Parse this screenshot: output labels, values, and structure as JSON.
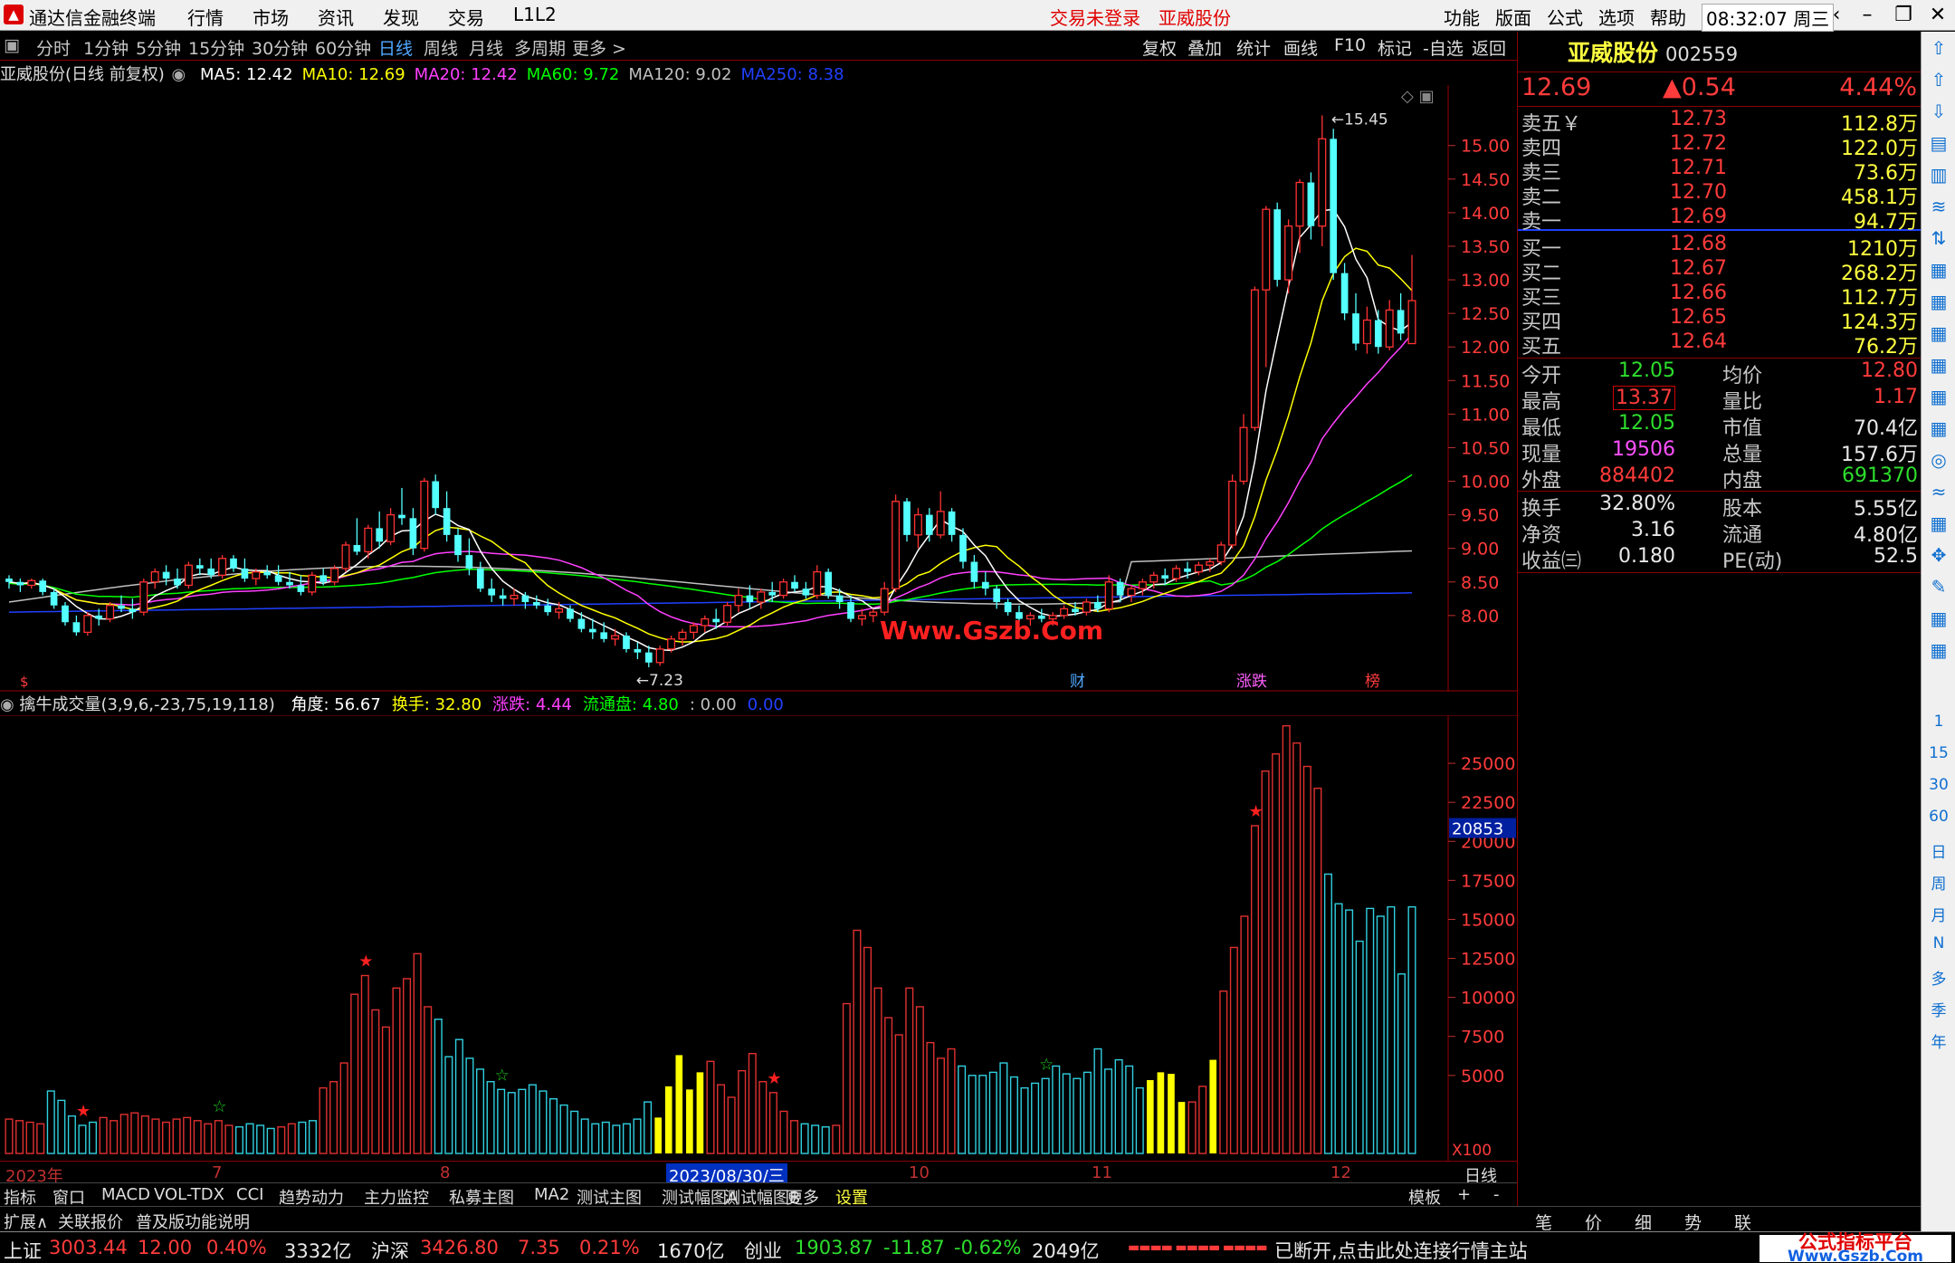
{
  "menubar": {
    "app_title": "通达信金融终端",
    "items": [
      "行情",
      "市场",
      "资讯",
      "发现",
      "交易",
      "L1L2"
    ],
    "trade_status": "交易未登录",
    "stock_name": "亚威股份",
    "right_items": [
      "功能",
      "版面",
      "公式",
      "选项",
      "帮助"
    ],
    "time": "08:32:07",
    "weekday": "周三"
  },
  "periods": {
    "items": [
      "分时",
      "1分钟",
      "5分钟",
      "15分钟",
      "30分钟",
      "60分钟",
      "日线",
      "周线",
      "月线",
      "多周期",
      "更多 >"
    ],
    "selected": "日线",
    "tools": [
      "复权",
      "叠加",
      "统计",
      "画线",
      "F10",
      "标记",
      "-自选",
      "返回"
    ]
  },
  "ma_legend": {
    "title": "亚威股份(日线 前复权)",
    "items": [
      {
        "label": "MA5: 12.42",
        "color": "#ffffff"
      },
      {
        "label": "MA10: 12.69",
        "color": "#ffff00"
      },
      {
        "label": "MA20: 12.42",
        "color": "#ff40ff"
      },
      {
        "label": "MA60: 9.72",
        "color": "#00ff00"
      },
      {
        "label": "MA120: 9.02",
        "color": "#c0c0c0"
      },
      {
        "label": "MA250: 8.38",
        "color": "#2040ff"
      }
    ]
  },
  "chart_data": [
    {
      "type": "candlestick",
      "title": "亚威股份(日线 前复权)",
      "y_ticks": [
        8.0,
        8.5,
        9.0,
        9.5,
        10.0,
        10.5,
        11.0,
        11.5,
        12.0,
        12.5,
        13.0,
        13.5,
        14.0,
        14.5,
        15.0
      ],
      "ylim": [
        7.0,
        15.9
      ],
      "high_label": "15.45",
      "low_label": "7.23",
      "time_ticks": [
        "2023年",
        "7",
        "8",
        "2023/08/30/三",
        "10",
        "11",
        "12"
      ],
      "period_label": "日线",
      "markers": [
        "财",
        "涨跌",
        "榜"
      ],
      "ohlc": [
        [
          8.55,
          8.6,
          8.4,
          8.5
        ],
        [
          8.5,
          8.55,
          8.35,
          8.45
        ],
        [
          8.45,
          8.55,
          8.4,
          8.52
        ],
        [
          8.52,
          8.55,
          8.3,
          8.35
        ],
        [
          8.35,
          8.4,
          8.1,
          8.15
        ],
        [
          8.15,
          8.2,
          7.85,
          7.9
        ],
        [
          7.9,
          8.0,
          7.7,
          7.75
        ],
        [
          7.75,
          8.05,
          7.7,
          8.0
        ],
        [
          8.0,
          8.1,
          7.85,
          7.95
        ],
        [
          7.95,
          8.2,
          7.9,
          8.15
        ],
        [
          8.15,
          8.3,
          8.05,
          8.1
        ],
        [
          8.1,
          8.25,
          7.95,
          8.05
        ],
        [
          8.05,
          8.55,
          8.0,
          8.5
        ],
        [
          8.5,
          8.7,
          8.4,
          8.65
        ],
        [
          8.65,
          8.75,
          8.45,
          8.55
        ],
        [
          8.55,
          8.7,
          8.4,
          8.45
        ],
        [
          8.45,
          8.8,
          8.4,
          8.75
        ],
        [
          8.75,
          8.85,
          8.6,
          8.7
        ],
        [
          8.7,
          8.85,
          8.55,
          8.6
        ],
        [
          8.6,
          8.9,
          8.55,
          8.85
        ],
        [
          8.85,
          8.9,
          8.65,
          8.7
        ],
        [
          8.7,
          8.85,
          8.5,
          8.55
        ],
        [
          8.55,
          8.7,
          8.45,
          8.65
        ],
        [
          8.65,
          8.75,
          8.55,
          8.6
        ],
        [
          8.6,
          8.75,
          8.45,
          8.5
        ],
        [
          8.5,
          8.65,
          8.4,
          8.45
        ],
        [
          8.45,
          8.6,
          8.3,
          8.35
        ],
        [
          8.35,
          8.65,
          8.3,
          8.6
        ],
        [
          8.6,
          8.7,
          8.45,
          8.5
        ],
        [
          8.5,
          8.75,
          8.45,
          8.7
        ],
        [
          8.7,
          9.1,
          8.65,
          9.05
        ],
        [
          9.05,
          9.45,
          8.9,
          8.95
        ],
        [
          8.95,
          9.35,
          8.85,
          9.3
        ],
        [
          9.3,
          9.55,
          9.0,
          9.1
        ],
        [
          9.1,
          9.6,
          9.05,
          9.5
        ],
        [
          9.5,
          9.9,
          9.35,
          9.45
        ],
        [
          9.45,
          9.6,
          8.9,
          9.0
        ],
        [
          9.0,
          10.05,
          8.95,
          10.0
        ],
        [
          10.0,
          10.1,
          9.5,
          9.6
        ],
        [
          9.6,
          9.85,
          9.1,
          9.2
        ],
        [
          9.2,
          9.3,
          8.8,
          8.9
        ],
        [
          8.9,
          9.15,
          8.6,
          8.7
        ],
        [
          8.7,
          8.8,
          8.35,
          8.4
        ],
        [
          8.4,
          8.55,
          8.2,
          8.3
        ],
        [
          8.3,
          8.4,
          8.15,
          8.25
        ],
        [
          8.25,
          8.4,
          8.15,
          8.3
        ],
        [
          8.3,
          8.35,
          8.1,
          8.2
        ],
        [
          8.2,
          8.3,
          8.1,
          8.15
        ],
        [
          8.15,
          8.25,
          8.0,
          8.05
        ],
        [
          8.05,
          8.2,
          7.95,
          8.1
        ],
        [
          8.1,
          8.15,
          7.9,
          7.95
        ],
        [
          7.95,
          8.05,
          7.75,
          7.8
        ],
        [
          7.8,
          7.95,
          7.65,
          7.75
        ],
        [
          7.75,
          7.9,
          7.6,
          7.65
        ],
        [
          7.65,
          7.8,
          7.55,
          7.7
        ],
        [
          7.7,
          7.75,
          7.45,
          7.5
        ],
        [
          7.5,
          7.6,
          7.35,
          7.45
        ],
        [
          7.45,
          7.55,
          7.23,
          7.3
        ],
        [
          7.3,
          7.55,
          7.25,
          7.5
        ],
        [
          7.5,
          7.7,
          7.45,
          7.65
        ],
        [
          7.65,
          7.8,
          7.55,
          7.75
        ],
        [
          7.75,
          7.9,
          7.65,
          7.85
        ],
        [
          7.85,
          8.0,
          7.75,
          7.95
        ],
        [
          7.95,
          8.1,
          7.8,
          7.9
        ],
        [
          7.9,
          8.2,
          7.85,
          8.15
        ],
        [
          8.15,
          8.4,
          8.05,
          8.3
        ],
        [
          8.3,
          8.45,
          8.1,
          8.2
        ],
        [
          8.2,
          8.4,
          8.1,
          8.35
        ],
        [
          8.35,
          8.5,
          8.2,
          8.3
        ],
        [
          8.3,
          8.55,
          8.25,
          8.5
        ],
        [
          8.5,
          8.6,
          8.35,
          8.4
        ],
        [
          8.4,
          8.5,
          8.25,
          8.3
        ],
        [
          8.3,
          8.75,
          8.25,
          8.65
        ],
        [
          8.65,
          8.7,
          8.25,
          8.3
        ],
        [
          8.3,
          8.4,
          8.1,
          8.2
        ],
        [
          8.2,
          8.3,
          7.9,
          7.95
        ],
        [
          7.95,
          8.1,
          7.85,
          8.0
        ],
        [
          8.0,
          8.1,
          7.9,
          8.05
        ],
        [
          8.05,
          8.5,
          8.0,
          8.4
        ],
        [
          8.4,
          9.8,
          8.35,
          9.7
        ],
        [
          9.7,
          9.75,
          9.1,
          9.2
        ],
        [
          9.2,
          9.6,
          9.0,
          9.5
        ],
        [
          9.5,
          9.6,
          9.1,
          9.2
        ],
        [
          9.2,
          9.85,
          9.15,
          9.55
        ],
        [
          9.55,
          9.6,
          9.1,
          9.2
        ],
        [
          9.2,
          9.3,
          8.7,
          8.8
        ],
        [
          8.8,
          8.9,
          8.4,
          8.5
        ],
        [
          8.5,
          8.65,
          8.3,
          8.4
        ],
        [
          8.4,
          8.45,
          8.1,
          8.2
        ],
        [
          8.2,
          8.25,
          8.0,
          8.05
        ],
        [
          8.05,
          8.15,
          7.9,
          7.95
        ],
        [
          7.95,
          8.05,
          7.85,
          8.0
        ],
        [
          8.0,
          8.1,
          7.9,
          7.95
        ],
        [
          7.95,
          8.05,
          7.85,
          8.0
        ],
        [
          8.0,
          8.15,
          7.95,
          8.1
        ],
        [
          8.1,
          8.2,
          8.0,
          8.05
        ],
        [
          8.05,
          8.25,
          8.0,
          8.2
        ],
        [
          8.2,
          8.3,
          8.05,
          8.1
        ],
        [
          8.1,
          8.6,
          8.05,
          8.5
        ],
        [
          8.5,
          8.55,
          8.2,
          8.3
        ],
        [
          8.3,
          8.45,
          8.2,
          8.4
        ],
        [
          8.4,
          8.55,
          8.3,
          8.5
        ],
        [
          8.5,
          8.65,
          8.4,
          8.6
        ],
        [
          8.6,
          8.7,
          8.45,
          8.55
        ],
        [
          8.55,
          8.75,
          8.5,
          8.7
        ],
        [
          8.7,
          8.8,
          8.55,
          8.65
        ],
        [
          8.65,
          8.8,
          8.6,
          8.75
        ],
        [
          8.75,
          8.85,
          8.65,
          8.8
        ],
        [
          8.8,
          9.1,
          8.75,
          9.05
        ],
        [
          9.05,
          10.1,
          9.0,
          10.0
        ],
        [
          10.0,
          11.0,
          9.95,
          10.8
        ],
        [
          10.8,
          12.9,
          10.75,
          12.85
        ],
        [
          12.85,
          14.1,
          11.7,
          14.05
        ],
        [
          14.05,
          14.15,
          12.9,
          13.0
        ],
        [
          13.0,
          13.9,
          12.8,
          13.8
        ],
        [
          13.8,
          14.5,
          13.4,
          14.45
        ],
        [
          14.45,
          14.6,
          13.6,
          13.8
        ],
        [
          13.8,
          15.45,
          13.5,
          15.1
        ],
        [
          15.1,
          15.25,
          13.0,
          13.1
        ],
        [
          13.1,
          13.25,
          12.4,
          12.5
        ],
        [
          12.5,
          12.8,
          11.95,
          12.05
        ],
        [
          12.05,
          12.6,
          11.9,
          12.4
        ],
        [
          12.4,
          12.55,
          11.9,
          12.0
        ],
        [
          12.0,
          12.7,
          11.95,
          12.55
        ],
        [
          12.55,
          12.8,
          12.1,
          12.2
        ],
        [
          12.05,
          13.37,
          12.05,
          12.69
        ]
      ]
    },
    {
      "type": "bar",
      "title": "擒牛成交量(3,9,6,-23,75,19,118)",
      "y_ticks": [
        5000,
        7500,
        10000,
        12500,
        15000,
        17500,
        20000,
        22500,
        25000
      ],
      "ylim": [
        0,
        27500
      ],
      "unit": "X100",
      "current_label": "20853",
      "values": [
        2200,
        2100,
        2000,
        1900,
        4000,
        3400,
        2400,
        1800,
        2000,
        2300,
        2100,
        2500,
        2600,
        2400,
        2200,
        2000,
        2200,
        2300,
        2100,
        1900,
        2100,
        1800,
        1700,
        1900,
        1800,
        1600,
        1700,
        1900,
        2000,
        2100,
        4200,
        4600,
        5800,
        10200,
        11400,
        9200,
        8100,
        10600,
        11200,
        12800,
        9400,
        8600,
        6200,
        7300,
        6100,
        5400,
        4600,
        4100,
        3900,
        4100,
        4400,
        4000,
        3500,
        3100,
        2700,
        2200,
        1900,
        2000,
        1800,
        1900,
        2200,
        3300,
        2300,
        4300,
        6300,
        4100,
        5200,
        5900,
        4400,
        3600,
        5300,
        6400,
        4600,
        3900,
        2700,
        2100,
        1900,
        1800,
        1700,
        1800,
        9600,
        14300,
        13200,
        10600,
        8700,
        7600,
        10600,
        9400,
        7100,
        6100,
        6700,
        5600,
        5000,
        5000,
        5200,
        5800,
        4900,
        4200,
        4500,
        4800,
        5600,
        5100,
        4800,
        5200,
        6700,
        5400,
        6000,
        5600,
        4200,
        4700,
        5200,
        5100,
        3300,
        3300,
        4300,
        6000,
        10400,
        13200,
        15200,
        21000,
        24500,
        25600,
        27400,
        26300,
        24800,
        23400,
        17900,
        16000,
        15600,
        13600,
        15700,
        15200,
        15800,
        11500,
        15800
      ],
      "colors": [
        "r",
        "r",
        "r",
        "r",
        "c",
        "c",
        "c",
        "c",
        "c",
        "r",
        "r",
        "r",
        "r",
        "r",
        "r",
        "r",
        "r",
        "r",
        "r",
        "r",
        "r",
        "r",
        "c",
        "c",
        "c",
        "c",
        "r",
        "r",
        "c",
        "c",
        "r",
        "r",
        "r",
        "r",
        "r",
        "r",
        "r",
        "r",
        "r",
        "r",
        "r",
        "c",
        "c",
        "c",
        "c",
        "c",
        "c",
        "c",
        "c",
        "c",
        "c",
        "c",
        "c",
        "c",
        "c",
        "c",
        "c",
        "c",
        "c",
        "c",
        "c",
        "c",
        "y",
        "y",
        "y",
        "y",
        "y",
        "r",
        "r",
        "r",
        "r",
        "r",
        "r",
        "r",
        "r",
        "r",
        "c",
        "c",
        "c",
        "r",
        "r",
        "r",
        "r",
        "r",
        "r",
        "r",
        "r",
        "r",
        "r",
        "r",
        "r",
        "c",
        "c",
        "c",
        "c",
        "c",
        "c",
        "c",
        "c",
        "c",
        "c",
        "c",
        "c",
        "c",
        "c",
        "c",
        "c",
        "c",
        "c",
        "y",
        "y",
        "y",
        "y",
        "r",
        "r",
        "y",
        "r",
        "r",
        "r",
        "r",
        "r",
        "r",
        "r",
        "r",
        "r",
        "r",
        "c",
        "c",
        "c",
        "c",
        "c",
        "c",
        "c",
        "c",
        "c"
      ],
      "stars": [
        {
          "i": 7,
          "c": "red"
        },
        {
          "i": 20,
          "c": "green"
        },
        {
          "i": 34,
          "c": "red"
        },
        {
          "i": 47,
          "c": "green"
        },
        {
          "i": 73,
          "c": "red"
        },
        {
          "i": 99,
          "c": "green"
        },
        {
          "i": 119,
          "c": "red"
        }
      ]
    }
  ],
  "vol_legend": {
    "title": "擒牛成交量(3,9,6,-23,75,19,118)",
    "items": [
      {
        "label": "角度: 56.67",
        "color": "#ffffff"
      },
      {
        "label": "换手: 32.80",
        "color": "#ffff00"
      },
      {
        "label": "涨跌: 4.44",
        "color": "#ff40ff"
      },
      {
        "label": "流通盘: 4.80",
        "color": "#00ff00"
      },
      {
        "label": ": 0.00",
        "color": "#c0c0c0"
      },
      {
        "label": "0.00",
        "color": "#2040ff"
      }
    ]
  },
  "watermark_chart": "Www.Gszb.Com",
  "tabs": [
    "指标",
    "窗口",
    "MACD",
    "VOL-TDX",
    "CCI",
    "趋势动力",
    "主力监控",
    "私募主图",
    "MA2",
    "测试主图",
    "测试幅图A",
    "测试幅图B",
    "更多",
    "设置"
  ],
  "tabs_right": [
    "模板",
    "+",
    "-"
  ],
  "ext": [
    "扩展∧",
    "关联报价",
    "普及版功能说明"
  ],
  "quote": {
    "name": "亚威股份",
    "code": "002559",
    "price": "12.69",
    "change": "▲0.54",
    "pct": "4.44%",
    "asks": [
      [
        "卖五￥",
        "12.73",
        "112.8万"
      ],
      [
        "卖四",
        "12.72",
        "122.0万"
      ],
      [
        "卖三",
        "12.71",
        "73.6万"
      ],
      [
        "卖二",
        "12.70",
        "458.1万"
      ],
      [
        "卖一",
        "12.69",
        "94.7万"
      ]
    ],
    "bids": [
      [
        "买一",
        "12.68",
        "1210万"
      ],
      [
        "买二",
        "12.67",
        "268.2万"
      ],
      [
        "买三",
        "12.66",
        "112.7万"
      ],
      [
        "买四",
        "12.65",
        "124.3万"
      ],
      [
        "买五",
        "12.64",
        "76.2万"
      ]
    ],
    "stats1": [
      [
        "今开",
        "12.05",
        "green",
        "均价",
        "12.80",
        "red"
      ],
      [
        "最高",
        "13.37",
        "red",
        "量比",
        "1.17",
        "red"
      ],
      [
        "最低",
        "12.05",
        "green",
        "市值",
        "70.4亿",
        "white"
      ],
      [
        "现量",
        "19506",
        "magenta",
        "总量",
        "157.6万",
        "white"
      ],
      [
        "外盘",
        "884402",
        "red",
        "内盘",
        "691370",
        "green"
      ]
    ],
    "stats2": [
      [
        "换手",
        "32.80%",
        "白",
        "股本",
        "5.55亿"
      ],
      [
        "净资",
        "3.16",
        "白",
        "流通",
        "4.80亿"
      ],
      [
        "收益㈢",
        "0.180",
        "白",
        "PE(动)",
        "52.5"
      ]
    ]
  },
  "bottom_tabs": [
    "笔",
    "价",
    "细",
    "势",
    "联"
  ],
  "side_tools": [
    "1",
    "15",
    "30",
    "60",
    "日",
    "周",
    "月",
    "N",
    "多",
    "季",
    "年"
  ],
  "status": {
    "sh_name": "上证",
    "sh_val": "3003.44",
    "sh_chg": "12.00",
    "sh_pct": "0.40%",
    "sh_amt": "3332亿",
    "hs_name": "沪深",
    "hs_val": "3426.80",
    "hs_chg": "7.35",
    "hs_pct": "0.21%",
    "hs_amt": "1670亿",
    "cy_name": "创业",
    "cy_val": "1903.87",
    "cy_chg": "-11.87",
    "cy_pct": "-0.62%",
    "cy_amt": "2049亿",
    "conn_msg": "已断开,点击此处连接行情主站"
  },
  "site_mark": {
    "line1": "公式指标平台",
    "line2": "Www.Gszb.Com"
  }
}
